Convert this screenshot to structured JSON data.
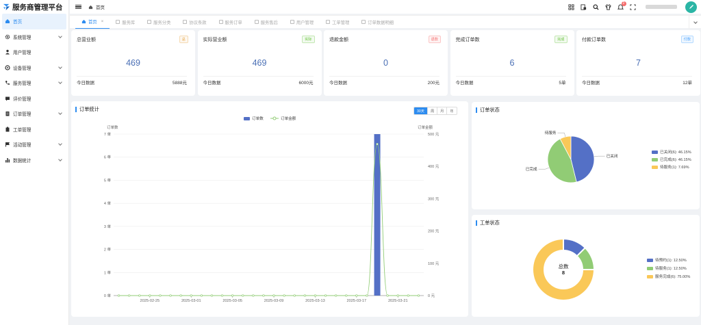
{
  "app": {
    "title": "服务商管理平台"
  },
  "sidebar": {
    "items": [
      {
        "label": "首页",
        "icon": "home-icon",
        "active": true,
        "chevron": false
      },
      {
        "label": "系统管理",
        "icon": "gear-icon",
        "chevron": true
      },
      {
        "label": "用户管理",
        "icon": "user-icon",
        "chevron": false
      },
      {
        "label": "设备管理",
        "icon": "device-icon",
        "chevron": true
      },
      {
        "label": "服务管理",
        "icon": "phone-icon",
        "chevron": true
      },
      {
        "label": "评价管理",
        "icon": "comment-icon",
        "chevron": false
      },
      {
        "label": "订单管理",
        "icon": "order-icon",
        "chevron": true
      },
      {
        "label": "工单管理",
        "icon": "ticket-icon",
        "chevron": false
      },
      {
        "label": "活动管理",
        "icon": "flag-icon",
        "chevron": true
      },
      {
        "label": "数据统计",
        "icon": "bar-chart-icon",
        "chevron": true
      }
    ]
  },
  "header": {
    "breadcrumb": "首页",
    "notifications": "2"
  },
  "tabs": [
    {
      "label": "首页",
      "active": true
    },
    {
      "label": "服务库"
    },
    {
      "label": "服务分类"
    },
    {
      "label": "协议条款"
    },
    {
      "label": "服务订单"
    },
    {
      "label": "服务售后"
    },
    {
      "label": "用户管理"
    },
    {
      "label": "工单管理"
    },
    {
      "label": "订单数据明细"
    }
  ],
  "cards": [
    {
      "title": "总营业额",
      "tag": "总",
      "tagColor": "#e6a23c",
      "value": "469",
      "footLabel": "今日数据",
      "footValue": "5888元"
    },
    {
      "title": "实际营业额",
      "tag": "实际",
      "tagColor": "#67c23a",
      "value": "469",
      "footLabel": "今日数据",
      "footValue": "6000元"
    },
    {
      "title": "退款金额",
      "tag": "退款",
      "tagColor": "#f56c6c",
      "value": "0",
      "footLabel": "今日数据",
      "footValue": "200元"
    },
    {
      "title": "完成订单数",
      "tag": "完成",
      "tagColor": "#67c23a",
      "value": "6",
      "footLabel": "今日数据",
      "footValue": "5单"
    },
    {
      "title": "付款订单数",
      "tag": "付款",
      "tagColor": "#409eff",
      "value": "7",
      "footLabel": "今日数据",
      "footValue": "12单"
    }
  ],
  "orderStats": {
    "title": "订单统计",
    "ranges": [
      "30天",
      "周",
      "月",
      "年"
    ],
    "activeRange": "30天",
    "legendCount": "订单数",
    "legendAmount": "订单金额",
    "ylabelLeft": "订单数",
    "ylabelRight": "订单金额"
  },
  "orderStatus": {
    "title": "订单状态",
    "legend": [
      "已关闭(6): 46.15%",
      "已完成(6): 46.15%",
      "待服务(1): 7.69%"
    ],
    "labels": [
      "已关闭",
      "已完成",
      "待服务"
    ]
  },
  "ticketStatus": {
    "title": "工单状态",
    "centerLabel": "总数",
    "centerValue": "8",
    "legend": [
      "待预约(1): 12.50%",
      "待服务(1): 12.50%",
      "服务完成(6): 75.00%"
    ]
  },
  "colors": {
    "blue": "#5470c6",
    "green": "#91cc75",
    "yellow": "#fac858",
    "accent": "#2d8cf0"
  },
  "chart_data": [
    {
      "type": "bar",
      "title": "订单统计",
      "ylabel": "订单数",
      "y2label": "订单金额",
      "ylim": [
        0,
        7
      ],
      "y2lim": [
        0,
        500
      ],
      "yticks": [
        "0 单",
        "1 单",
        "2 单",
        "3 单",
        "4 单",
        "5 单",
        "6 单",
        "7 单"
      ],
      "y2ticks": [
        "0 元",
        "100 元",
        "200 元",
        "300 元",
        "400 元",
        "500 元"
      ],
      "xticks": [
        "2025-02-25",
        "2025-03-01",
        "2025-03-05",
        "2025-03-09",
        "2025-03-13",
        "2025-03-17",
        "2025-03-21"
      ],
      "days": 30,
      "startDate": "2025-02-22",
      "series": [
        {
          "name": "订单数",
          "type": "bar",
          "peakDate": "2025-03-19",
          "values": [
            0,
            0,
            0,
            0,
            0,
            0,
            0,
            0,
            0,
            0,
            0,
            0,
            0,
            0,
            0,
            0,
            0,
            0,
            0,
            0,
            0,
            0,
            0,
            0,
            0,
            7,
            0,
            0,
            0,
            0
          ]
        },
        {
          "name": "订单金额",
          "type": "line",
          "values": [
            0,
            0,
            0,
            0,
            0,
            0,
            0,
            0,
            0,
            0,
            0,
            0,
            0,
            0,
            0,
            0,
            0,
            0,
            0,
            0,
            0,
            0,
            0,
            0,
            0,
            469,
            0,
            0,
            0,
            0
          ]
        }
      ],
      "legend": "top-center"
    },
    {
      "type": "pie",
      "title": "订单状态",
      "labels": [
        "已关闭",
        "已完成",
        "待服务"
      ],
      "values": [
        6,
        6,
        1
      ]
    },
    {
      "type": "pie",
      "title": "工单状态",
      "donut": true,
      "labels": [
        "待预约",
        "待服务",
        "服务完成"
      ],
      "values": [
        1,
        1,
        6
      ]
    }
  ]
}
